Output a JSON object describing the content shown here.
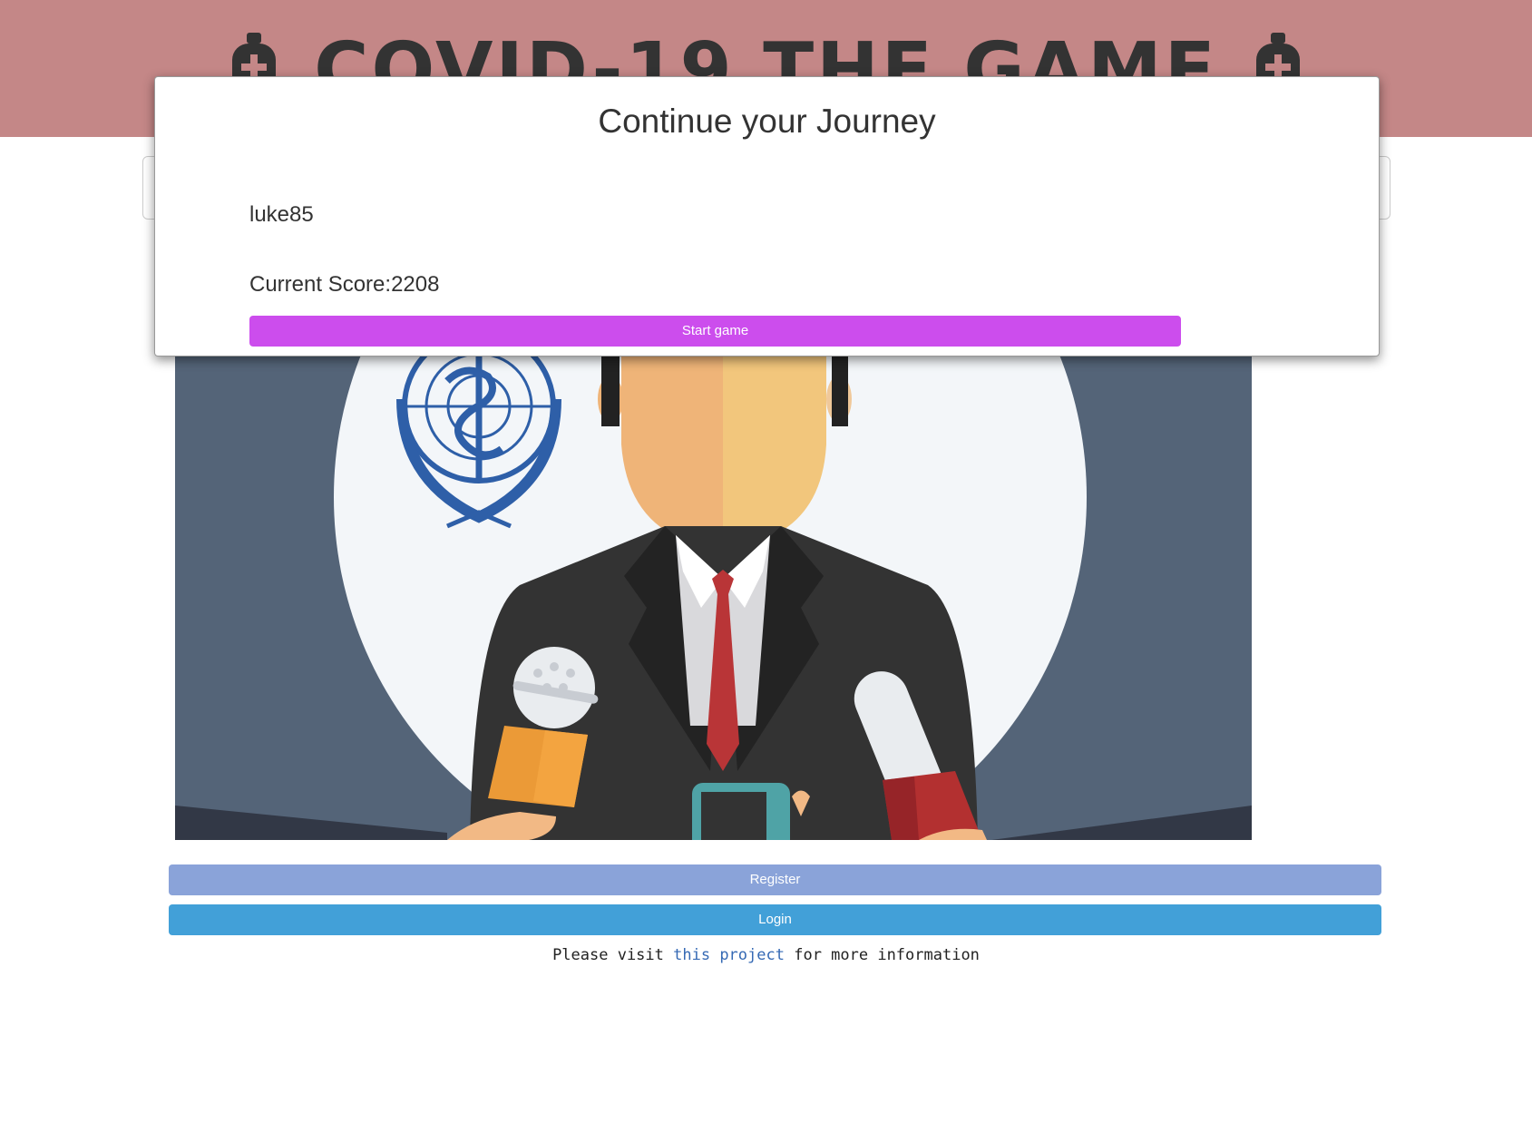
{
  "header": {
    "title": "COVID-19 THE GAME",
    "icon_left": "medical-bottle-icon",
    "icon_right": "medical-bottle-icon",
    "background_color": "#c48787"
  },
  "modal": {
    "title": "Continue your Journey",
    "username": "luke85",
    "score_label": "Current Score:",
    "score_value": "2208",
    "start_button_label": "Start game",
    "start_button_color": "#cc4ded"
  },
  "hero_image": {
    "subject": "who-press-conference-illustration"
  },
  "actions": {
    "register_label": "Register",
    "register_color": "#8aa3d9",
    "login_label": "Login",
    "login_color": "#42a0d8"
  },
  "footer": {
    "prefix": "Please visit",
    "link_text": "this project",
    "suffix": "for more information"
  }
}
